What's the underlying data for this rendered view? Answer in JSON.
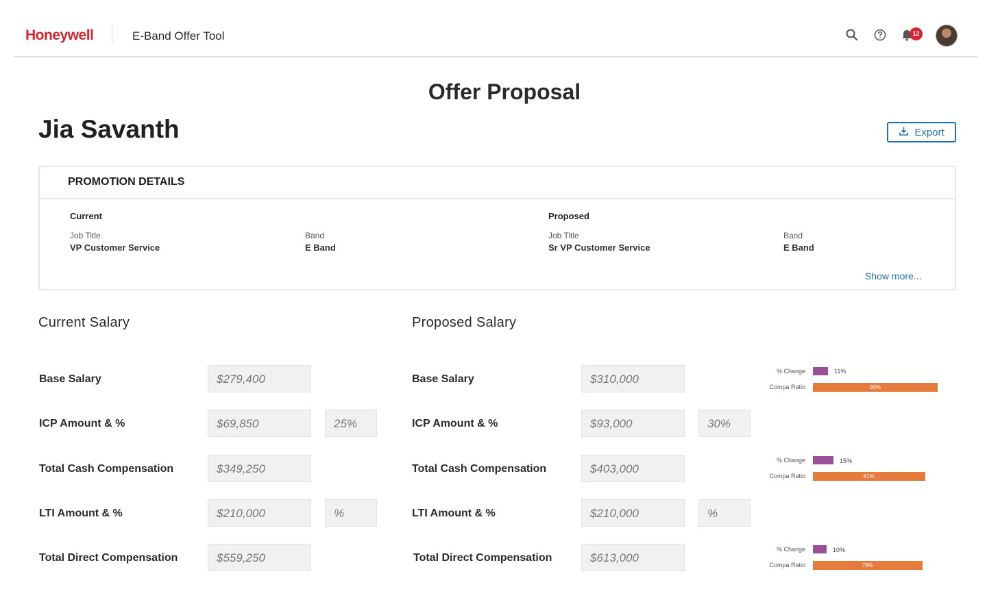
{
  "header": {
    "logo": "Honeywell",
    "app_title": "E-Band Offer Tool",
    "notification_count": "12"
  },
  "page_title": "Offer Proposal",
  "employee_name": "Jia Savanth",
  "export_label": "Export",
  "promotion": {
    "heading": "PROMOTION DETAILS",
    "current": {
      "title": "Current",
      "job_title_label": "Job Title",
      "job_title": "VP Customer Service",
      "band_label": "Band",
      "band": "E Band"
    },
    "proposed": {
      "title": "Proposed",
      "job_title_label": "Job Title",
      "job_title": "Sr VP Customer Service",
      "band_label": "Band",
      "band": "E Band"
    },
    "show_more": "Show more..."
  },
  "current_salary": {
    "title": "Current Salary",
    "base_label": "Base Salary",
    "base": "$279,400",
    "icp_label": "ICP Amount & %",
    "icp_amount": "$69,850",
    "icp_pct": "25%",
    "tcc_label": "Total Cash Compensation",
    "tcc": "$349,250",
    "lti_label": "LTI Amount & %",
    "lti_amount": "$210,000",
    "lti_pct": "%",
    "tdc_label": "Total Direct Compensation",
    "tdc": "$559,250"
  },
  "proposed_salary": {
    "title": "Proposed Salary",
    "base_label": "Base Salary",
    "base": "$310,000",
    "icp_label": "ICP Amount & %",
    "icp_amount": "$93,000",
    "icp_pct": "30%",
    "tcc_label": "Total Cash Compensation",
    "tcc": "$403,000",
    "lti_label": "LTI Amount & %",
    "lti_amount": "$210,000",
    "lti_pct": "%",
    "tdc_label": "Total Direct Compensation",
    "tdc": "$613,000"
  },
  "metrics": {
    "pct_change_label": "% Change",
    "compa_ratio_label": "Compa Ratio",
    "base": {
      "pct_change": 11,
      "pct_change_text": "11%",
      "compa_ratio": 90,
      "compa_ratio_text": "90%"
    },
    "tcc": {
      "pct_change": 15,
      "pct_change_text": "15%",
      "compa_ratio": 81,
      "compa_ratio_text": "81%"
    },
    "tdc": {
      "pct_change": 10,
      "pct_change_text": "10%",
      "compa_ratio": 79,
      "compa_ratio_text": "79%"
    }
  },
  "colors": {
    "brand_red": "#d22630",
    "link_blue": "#1f6fb3",
    "pct_change_bar": "#9b4f96",
    "compa_ratio_bar": "#e57c3d"
  }
}
